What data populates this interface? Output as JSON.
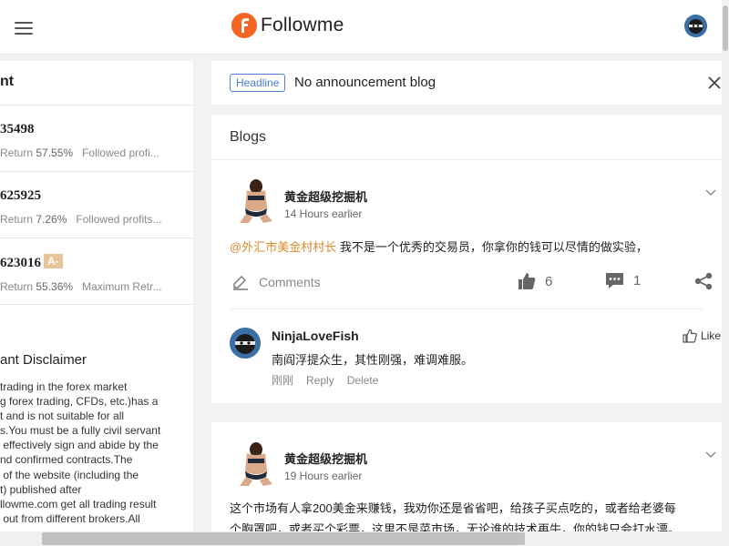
{
  "header": {
    "logo_text": "Followme",
    "brand_color": "#f26522"
  },
  "left_panel": {
    "title": "nt",
    "traders": [
      {
        "id": "35498",
        "return_label": "Return",
        "return_value": "57.55%",
        "extra": "Followed profi..."
      },
      {
        "id": "625925",
        "return_label": "Return",
        "return_value": "7.26%",
        "extra": "Followed profits..."
      },
      {
        "id": "623016",
        "grade": "A-",
        "return_label": "Return",
        "return_value": "55.36%",
        "extra": "Maximum Retr..."
      }
    ],
    "disclaimer_title": "ant Disclaimer",
    "disclaimer_body": "trading in the forex market\ng forex trading, CFDs, etc.)has a\nt and is not suitable for all\ns.You must be a fully civil servant\n effectively sign and abide by the\nnd confirmed contracts.The\n of the website (including the\nt) published after\nllowme.com get all trading result\n out from different brokers.All"
  },
  "announcement": {
    "badge": "Headline",
    "text": "No announcement blog"
  },
  "blogs": {
    "title": "Blogs",
    "posts": [
      {
        "author": "黄金超级挖掘机",
        "time": "14 Hours earlier",
        "mention": "@外汇市美金村村长",
        "text": " 我不是一个优秀的交易员，你拿你的钱可以尽情的做实验，",
        "comments_label": "Comments",
        "likes": "6",
        "comments_count": "1",
        "comment": {
          "author": "NinjaLoveFish",
          "text": "南阎浮提众生，其性刚强，难调难服。",
          "time": "刚刚",
          "reply_label": "Reply",
          "delete_label": "Delete",
          "like_label": "Like"
        }
      },
      {
        "author": "黄金超级挖掘机",
        "time": "19 Hours earlier",
        "text_line1": "这个市场有人拿200美金来赚钱，我劝你还是省省吧，给孩子买点吃的，或者给老婆每",
        "text_line2": "个胸罩吧，或者买个彩票，这里不是菜市场，无论谁的技术再牛，你的钱只会打水漂。"
      }
    ]
  }
}
